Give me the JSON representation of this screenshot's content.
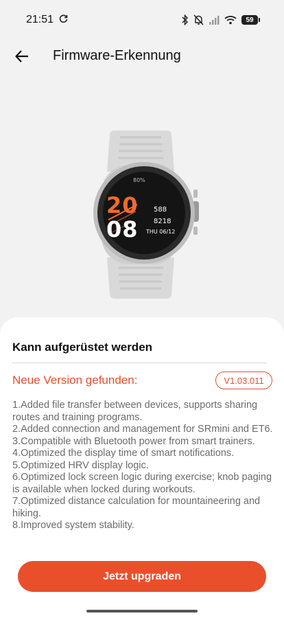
{
  "status": {
    "time": "21:51",
    "battery": "59"
  },
  "header": {
    "title": "Firmware-Erkennung"
  },
  "watch": {
    "battery_text": "80%",
    "hour": "20",
    "minute": "08",
    "stat1": "588",
    "stat2": "8218",
    "date": "THU 06/12",
    "accent_color": "#f26a2c"
  },
  "sheet": {
    "title": "Kann aufgerüstet werden",
    "new_version_label": "Neue Version gefunden:",
    "version": "V1.03.011",
    "changelog": [
      "1.Added file transfer between devices, supports sharing routes and training programs.",
      "2.Added connection and management for SRmini and ET6.",
      "3.Compatible with Bluetooth power from smart trainers.",
      "4.Optimized the display time of smart notifications.",
      "5.Optimized HRV display logic.",
      "6.Optimized lock screen logic during exercise; knob paging is available when locked during workouts.",
      "7.Optimized distance calculation for mountaineering and hiking.",
      "8.Improved system stability."
    ]
  },
  "actions": {
    "upgrade_label": "Jetzt upgraden"
  },
  "colors": {
    "accent": "#e3502c",
    "button": "#ea4f2c"
  }
}
